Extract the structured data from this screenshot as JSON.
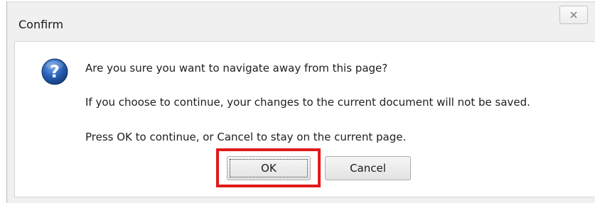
{
  "dialog": {
    "title": "Confirm",
    "close_label": "✕",
    "icon": "question-icon",
    "messages": [
      "Are you sure you want to navigate away from this page?",
      "If you choose to continue, your changes to the current document will not be saved.",
      "Press OK to continue, or Cancel to stay on the current page."
    ],
    "buttons": {
      "ok_label": "OK",
      "cancel_label": "Cancel"
    },
    "highlight_color": "#e01a1a",
    "accent_color": "#2a62b8"
  }
}
